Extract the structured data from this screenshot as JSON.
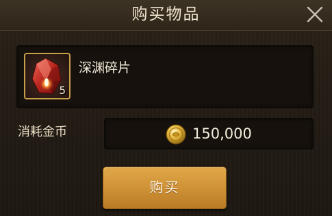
{
  "dialog": {
    "title": "购买物品",
    "close_icon": "close-icon"
  },
  "item": {
    "name": "深渊碎片",
    "count": "5",
    "icon": "red-crystal-shard-icon"
  },
  "cost": {
    "label": "消耗金币",
    "value": "150,000",
    "icon": "gold-coin-icon"
  },
  "actions": {
    "buy_label": "购买"
  },
  "colors": {
    "accent_gold": "#d29438",
    "slot_border": "#c9a04a",
    "panel_bg": "#16110c",
    "text_light": "#f4ecdc"
  }
}
